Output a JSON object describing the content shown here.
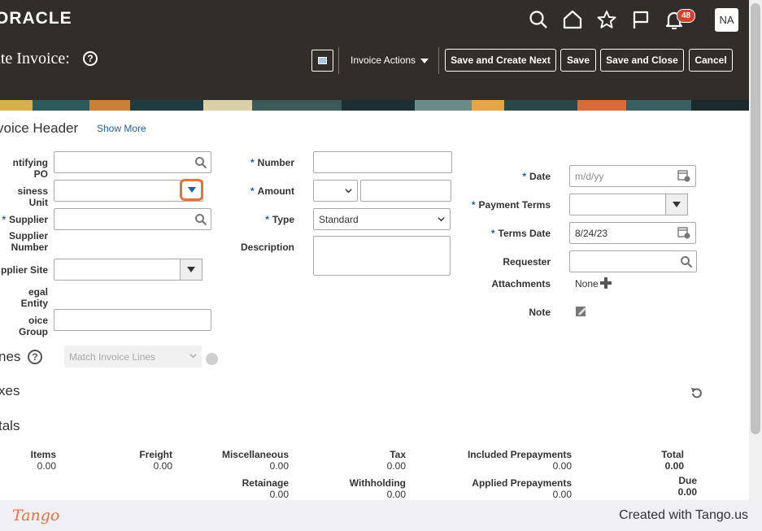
{
  "header": {
    "logo": "ORACLE",
    "page_title": "ate Invoice:",
    "help": "?",
    "notification_count": "48",
    "avatar_initials": "NA",
    "invoice_actions": "Invoice Actions",
    "buttons": {
      "save_create_next": "Save and Create Next",
      "save": "Save",
      "save_close": "Save and Close",
      "cancel": "Cancel"
    }
  },
  "invoice_header": {
    "title": "voice Header",
    "show_more": "Show More",
    "labels": {
      "identifying_po": "ntifying PO",
      "business_unit": "siness Unit",
      "supplier": "Supplier",
      "supplier_number_1": "Supplier",
      "supplier_number_2": "Number",
      "supplier_site": "pplier Site",
      "legal_entity": "egal Entity",
      "invoice_group": "oice Group",
      "number": "Number",
      "amount": "Amount",
      "type": "Type",
      "description": "Description",
      "date": "Date",
      "payment_terms": "Payment Terms",
      "terms_date": "Terms Date",
      "requester": "Requester",
      "attachments": "Attachments",
      "note": "Note"
    },
    "required_marker": "*",
    "type_value": "Standard",
    "date_placeholder": "m/d/yy",
    "terms_date_value": "8/24/23",
    "attachments_value": "None"
  },
  "lines": {
    "title": "nes",
    "help": "?",
    "match_placeholder": "Match Invoice Lines"
  },
  "taxes": {
    "title": "xes"
  },
  "totals": {
    "title": "tals",
    "items_label": "Items",
    "items_value": "0.00",
    "freight_label": "Freight",
    "freight_value": "0.00",
    "misc_label": "Miscellaneous",
    "misc_value": "0.00",
    "tax_label": "Tax",
    "tax_value": "0.00",
    "included_prepay_label": "Included Prepayments",
    "included_prepay_value": "0.00",
    "total_label": "Total",
    "total_value": "0.00",
    "retainage_label": "Retainage",
    "retainage_value": "0.00",
    "withholding_label": "Withholding",
    "withholding_value": "0.00",
    "applied_prepay_label": "Applied Prepayments",
    "applied_prepay_value": "0.00",
    "due_label": "Due",
    "due_value": "0.00"
  },
  "footer": {
    "brand": "Tango",
    "created_with": "Created with Tango.us"
  },
  "colors": {
    "header_bg": "#312d2a",
    "required": "#1f5fa0",
    "highlight": "#e4743b"
  }
}
